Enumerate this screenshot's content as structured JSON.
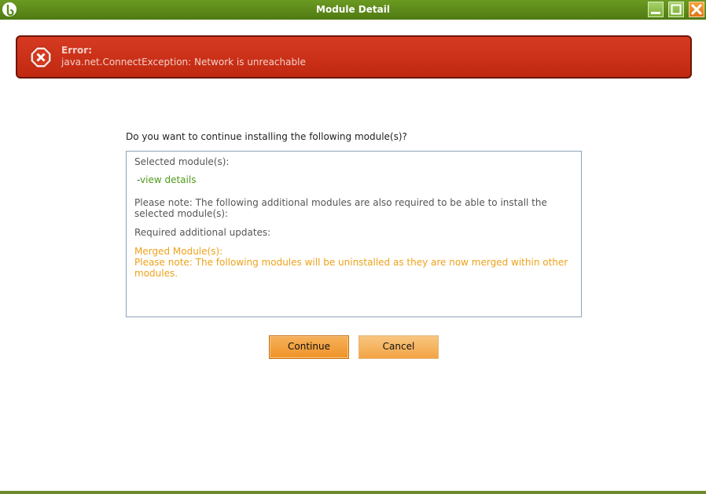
{
  "window": {
    "title": "Module Detail",
    "accent": "#5e8a1c"
  },
  "error": {
    "title": "Error:",
    "message": "java.net.ConnectException: Network is unreachable",
    "color": "#c8321a"
  },
  "dialog": {
    "question": "Do you want to continue installing the following module(s)?",
    "selected_label": "Selected module(s):",
    "dash": "-",
    "view_details": "view details",
    "note": "Please note: The following additional modules are also required to be able to install the selected module(s):",
    "required_label": "Required additional updates:",
    "merged_label": "Merged Module(s):",
    "merged_note": "Please note: The following modules will be uninstalled as they are now merged within other modules."
  },
  "buttons": {
    "continue": "Continue",
    "cancel": "Cancel"
  },
  "icons": {
    "logo": "app-logo-icon",
    "minimize": "minimize-icon",
    "maximize": "maximize-icon",
    "close": "close-icon",
    "error": "error-x-icon"
  }
}
